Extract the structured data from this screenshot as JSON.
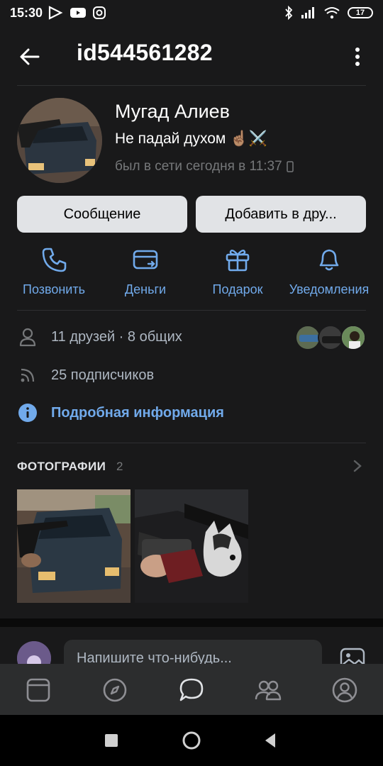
{
  "status_bar": {
    "time": "15:30",
    "battery": "17"
  },
  "header": {
    "title": "id544561282"
  },
  "profile": {
    "name": "Мугад Алиев",
    "status": "Не падай духом",
    "status_emoji": "☝🏽⚔️",
    "last_seen": "был в сети сегодня в 11:37"
  },
  "buttons": {
    "message": "Сообщение",
    "add_friend": "Добавить в дру..."
  },
  "actions": [
    {
      "label": "Позвонить",
      "icon": "phone-icon"
    },
    {
      "label": "Деньги",
      "icon": "money-icon"
    },
    {
      "label": "Подарок",
      "icon": "gift-icon"
    },
    {
      "label": "Уведомления",
      "icon": "bell-icon"
    }
  ],
  "info": {
    "friends": "11 друзей · 8 общих",
    "followers": "25 подписчиков",
    "details": "Подробная информация"
  },
  "photos": {
    "title": "ФОТОГРАФИИ",
    "count": "2"
  },
  "composer": {
    "placeholder": "Напишите что-нибудь..."
  },
  "tabs": [
    "feed-icon",
    "explore-icon",
    "messages-icon",
    "friends-icon",
    "profile-icon"
  ],
  "colors": {
    "accent": "#71aaeb",
    "background": "#19191a",
    "button": "#e1e3e6"
  }
}
